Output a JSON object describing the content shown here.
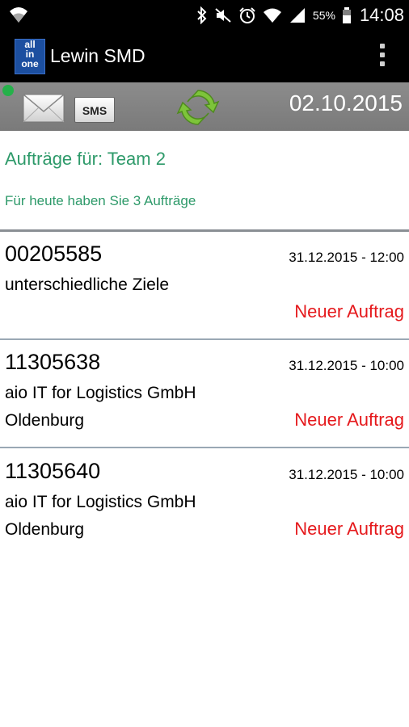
{
  "status_bar": {
    "battery": "55%",
    "time": "14:08"
  },
  "action_bar": {
    "logo_lines": [
      "all",
      "in",
      "one"
    ],
    "title": "Lewin SMD"
  },
  "toolbar": {
    "sms_label": "SMS",
    "date": "02.10.2015"
  },
  "header": {
    "team": "Aufträge für: Team 2",
    "info": "Für heute haben Sie 3 Aufträge"
  },
  "orders": [
    {
      "number": "00205585",
      "datetime": "31.12.2015 - 12:00",
      "line1": "unterschiedliche Ziele",
      "line2": "",
      "status": "Neuer Auftrag"
    },
    {
      "number": "11305638",
      "datetime": "31.12.2015 - 10:00",
      "line1": "aio IT for Logistics GmbH",
      "line2": "Oldenburg",
      "status": "Neuer Auftrag"
    },
    {
      "number": "11305640",
      "datetime": "31.12.2015 - 10:00",
      "line1": "aio IT for Logistics GmbH",
      "line2": "Oldenburg",
      "status": "Neuer Auftrag"
    }
  ]
}
